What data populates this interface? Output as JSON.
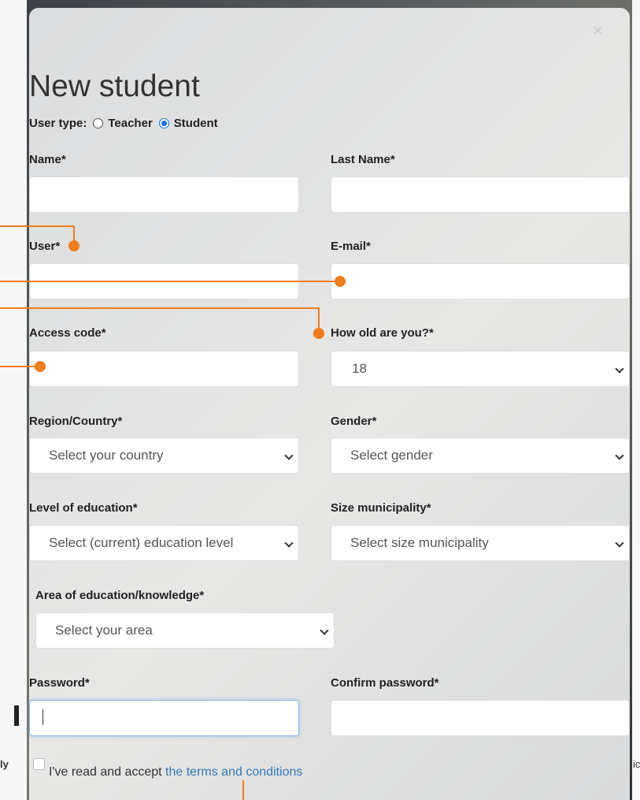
{
  "modal": {
    "title": "New student",
    "close_icon": "close-icon",
    "user_type": {
      "label": "User type:",
      "options": [
        {
          "label": "Teacher",
          "checked": false
        },
        {
          "label": "Student",
          "checked": true
        }
      ]
    },
    "fields": {
      "name": {
        "label": "Name*",
        "value": ""
      },
      "last_name": {
        "label": "Last Name*",
        "value": ""
      },
      "user": {
        "label": "User*",
        "value": ""
      },
      "email": {
        "label": "E-mail*",
        "value": ""
      },
      "access_code": {
        "label": "Access code*",
        "value": ""
      },
      "age": {
        "label": "How old are you?*",
        "value": "18"
      },
      "region": {
        "label": "Region/Country*",
        "value": "Select your country"
      },
      "gender": {
        "label": "Gender*",
        "value": "Select gender"
      },
      "education_level": {
        "label": "Level of education*",
        "value": "Select (current) education level"
      },
      "municipality": {
        "label": "Size municipality*",
        "value": "Select size municipality"
      },
      "area": {
        "label": "Area of education/knowledge*",
        "value": "Select your area"
      },
      "password": {
        "label": "Password*",
        "value": ""
      },
      "confirm_password": {
        "label": "Confirm password*",
        "value": ""
      }
    },
    "terms": {
      "text": "I've read and accept",
      "link": "the terms and conditions",
      "checked": false
    }
  },
  "background": {
    "left_text": "ly",
    "right_text": "ic"
  },
  "colors": {
    "annotation": "#f07c1a",
    "link": "#337ab7",
    "radio_selected": "#1a73e8"
  }
}
